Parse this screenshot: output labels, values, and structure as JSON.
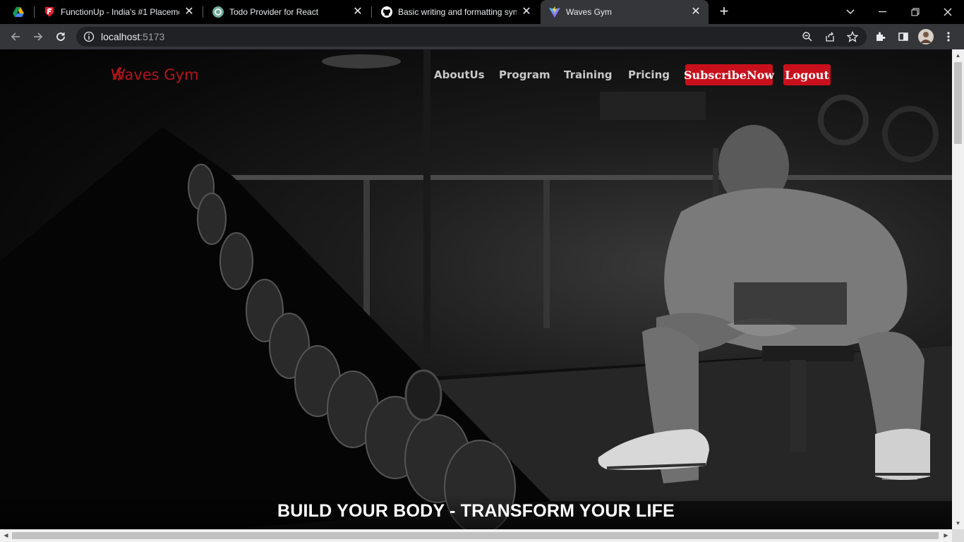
{
  "browser": {
    "tabs": [
      {
        "title": "",
        "icon": "google-drive-icon"
      },
      {
        "title": "FunctionUp - India's #1 Placemen",
        "icon": "functionup-icon"
      },
      {
        "title": "Todo Provider for React",
        "icon": "chatgpt-icon"
      },
      {
        "title": "Basic writing and formatting synt",
        "icon": "github-icon"
      },
      {
        "title": "Waves Gym",
        "icon": "vite-icon",
        "active": true
      }
    ],
    "url_host": "localhost",
    "url_port": ":5173"
  },
  "site": {
    "brand": "Waves Gym",
    "brand_color": "#b5121b",
    "nav": {
      "about": "AboutUs",
      "program": "Program",
      "training": "Training",
      "pricing": "Pricing"
    },
    "subscribe_label": "SubscribeNow",
    "logout_label": "Logout",
    "accent_color": "#c8101c",
    "hero_caption": "BUILD YOUR BODY - TRANSFORM YOUR LIFE"
  }
}
